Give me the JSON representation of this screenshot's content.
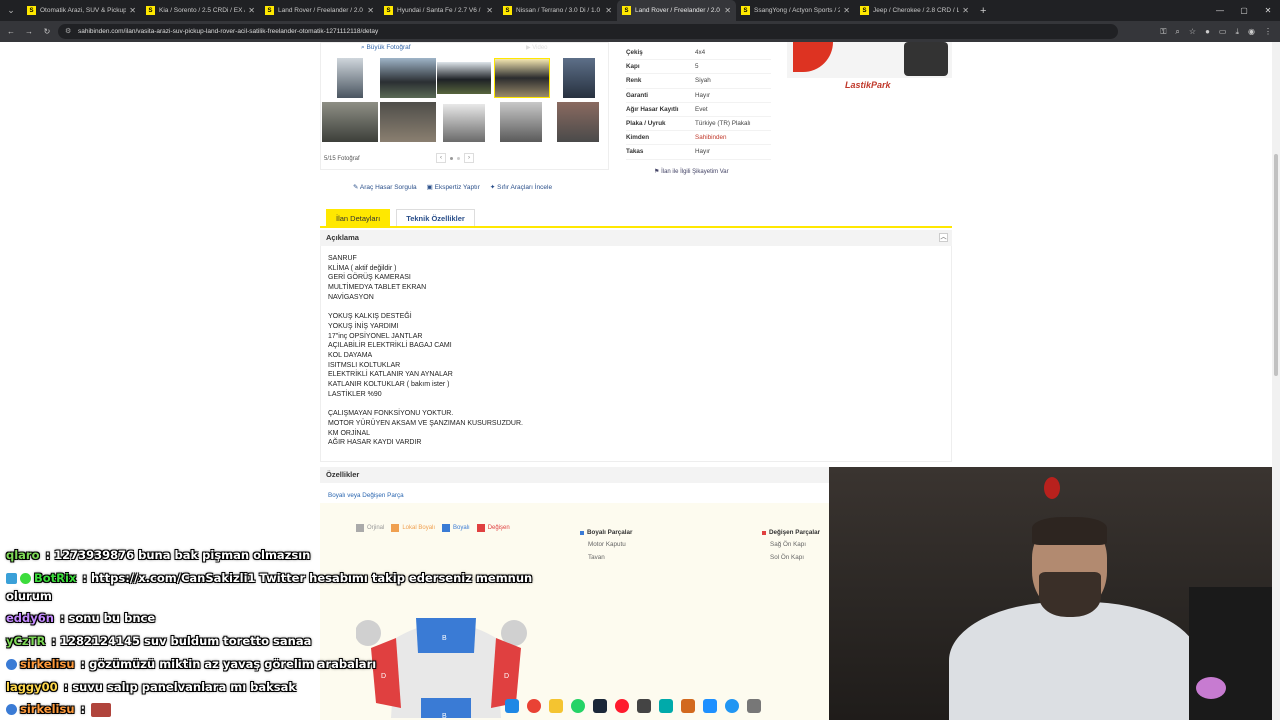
{
  "browser": {
    "tabs": [
      {
        "title": "Otomatik Arazi, SUV & Pickup | ",
        "active": false
      },
      {
        "title": "Kia / Sorento / 2.5 CRDi / EX / ",
        "active": false
      },
      {
        "title": "Land Rover / Freelander / 2.0 T",
        "active": false
      },
      {
        "title": "Hyundai / Santa Fe / 2.7 V6 / ",
        "active": false
      },
      {
        "title": "Nissan / Terrano / 3.0 Di / 1.0 ",
        "active": false
      },
      {
        "title": "Land Rover / Freelander / 2.0 T",
        "active": true
      },
      {
        "title": "SsangYong / Actyon Sports / 2",
        "active": false
      },
      {
        "title": "Jeep / Cherokee / 2.8 CRD / Lim",
        "active": false
      }
    ],
    "url": "sahibinden.com/ilan/vasita-arazi-suv-pickup-land-rover-acil-satilik-freelander-otomatik-1271112118/detay"
  },
  "gallery": {
    "big_photo_label": "Büyük Fotoğraf",
    "video_label": "Video",
    "count_label": "5/15 Fotoğraf"
  },
  "specs": [
    {
      "key": "Çekiş",
      "value": "4x4"
    },
    {
      "key": "Kapı",
      "value": "5"
    },
    {
      "key": "Renk",
      "value": "Siyah"
    },
    {
      "key": "Garanti",
      "value": "Hayır"
    },
    {
      "key": "Ağır Hasar Kayıtlı",
      "value": "Evet"
    },
    {
      "key": "Plaka / Uyruk",
      "value": "Türkiye (TR) Plakalı"
    },
    {
      "key": "Kimden",
      "value": "Sahibinden"
    },
    {
      "key": "Takas",
      "value": "Hayır"
    }
  ],
  "report_link": "İlan ile İlgili Şikayetim Var",
  "ad": {
    "logo": "LastikPark"
  },
  "links": {
    "damage": "Araç Hasar Sorgula",
    "expert": "Ekspertiz Yaptır",
    "zero": "Sıfır Araçları İncele"
  },
  "detail_tabs": {
    "details": "İlan Detayları",
    "tech": "Teknik Özellikler"
  },
  "description": {
    "heading": "Açıklama",
    "text": "SANRUF\nKLİMA ( aktif değildir )\nGERİ GÖRÜŞ KAMERASI\nMULTİMEDYA TABLET EKRAN\nNAVİGASYON\n\nYOKUŞ KALKIŞ DESTEĞİ\nYOKUŞ İNİŞ YARDIMI\n17\"inç OPSİYONEL JANTLAR\nAÇILABİLİR ELEKTRİKLİ BAGAJ CAMI\nKOL DAYAMA\nISITMSLI KOLTUKLAR\nELEKTRİKLİ KATLANIR YAN AYNALAR\nKATLANIR KOLTUKLAR ( bakım ister )\nLASTİKLER %90\n\nÇALIŞMAYAN FONKSİYONU YOKTUR.\nMOTOR YÜRÜYEN AKSAM VE ŞANZIMAN KUSURSUZDUR.\nKM ORJİNAL\nAĞIR HASAR KAYDI VARDIR"
  },
  "features": {
    "heading": "Özellikler",
    "link": "Boyalı veya Değişen Parça",
    "legend": [
      {
        "label": "Orjinal",
        "color": "#aaaaaa"
      },
      {
        "label": "Lokal Boyalı",
        "color": "#f0a050"
      },
      {
        "label": "Boyalı",
        "color": "#3a7bd5"
      },
      {
        "label": "Değişen",
        "color": "#e04040"
      }
    ],
    "painted_heading": "Boyalı Parçalar",
    "painted": [
      "Motor Kaputu",
      "Tavan"
    ],
    "changed_heading": "Değişen Parçalar",
    "changed": [
      "Sağ Ön Kapı",
      "Sol Ön Kapı"
    ],
    "car_labels": {
      "b": "B",
      "d": "D"
    }
  },
  "chat": [
    {
      "user": "qlaro",
      "color": "#7ed957",
      "text": " : 1273939876 buna bak pişman olmazsın"
    },
    {
      "user": "BotRix",
      "color": "#3cdc3c",
      "text": " : https://x.com/CanSakizli1 Twitter hesabımı takip ederseniz memnun",
      "badges": true
    },
    {
      "user": "",
      "color": "#ffffff",
      "text": "olurum"
    },
    {
      "user": "eddy6n",
      "color": "#c48bff",
      "text": " : sonu bu bnce"
    },
    {
      "user": "yCzTR",
      "color": "#7ed957",
      "text": " : 1282124145 suv buldum toretto sanaa"
    },
    {
      "user": "sirkelisu",
      "color": "#ff9a3c",
      "text": " : gözümüzü miktin az yavaş görelim arabaları",
      "badges": true
    },
    {
      "user": "laggy00",
      "color": "#ffd84d",
      "text": " : suvu salıp panelvanlara mı baksak"
    },
    {
      "user": "sirkelisu",
      "color": "#ff9a3c",
      "text": " :",
      "badges": true
    }
  ]
}
